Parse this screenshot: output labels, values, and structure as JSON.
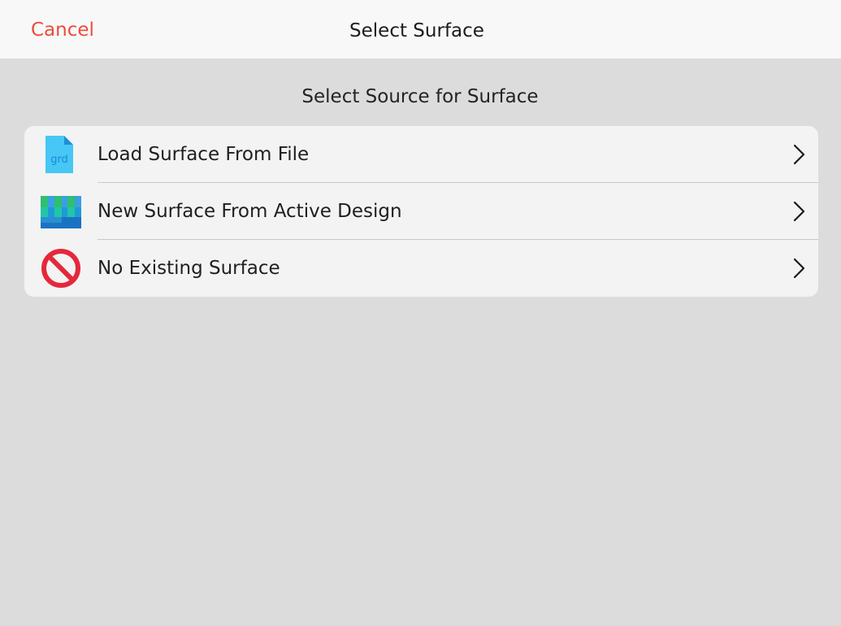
{
  "navbar": {
    "cancel_label": "Cancel",
    "title": "Select Surface"
  },
  "section": {
    "header": "Select Source for Surface"
  },
  "options": [
    {
      "label": "Load Surface From File",
      "icon": "grd-file-icon",
      "icon_text": "grd"
    },
    {
      "label": "New Surface From Active Design",
      "icon": "surface-grid-icon"
    },
    {
      "label": "No Existing Surface",
      "icon": "no-entry-icon"
    }
  ],
  "colors": {
    "accent_cancel": "#ee4b3d",
    "background": "#dcdcdc",
    "list_background": "#f3f3f3",
    "no_entry_red": "#e5283b",
    "file_icon_blue": "#46c7f5"
  }
}
